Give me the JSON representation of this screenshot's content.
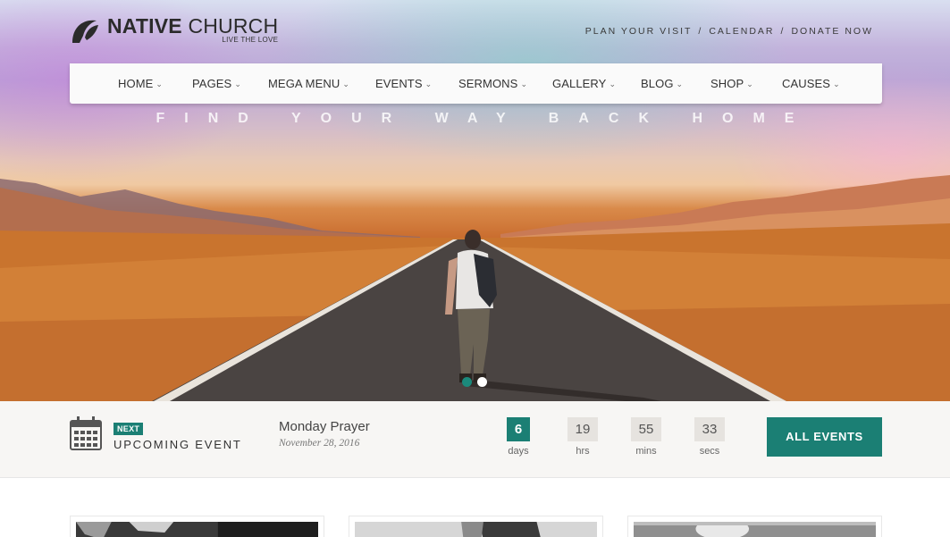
{
  "brand": {
    "name_bold": "NATIVE",
    "name_light": "CHURCH",
    "tagline": "LIVE THE LOVE",
    "logo_icon": "church-arc-logo-icon"
  },
  "top_links": [
    "PLAN YOUR VISIT",
    "CALENDAR",
    "DONATE NOW"
  ],
  "top_links_separator": "/",
  "nav": {
    "items": [
      "HOME",
      "PAGES",
      "MEGA MENU",
      "EVENTS",
      "SERMONS",
      "GALLERY",
      "BLOG",
      "SHOP",
      "CAUSES"
    ],
    "chevron": "⌄"
  },
  "hero": {
    "tagline": "FIND YOUR WAY BACK HOME",
    "slides_total": 2,
    "active_slide": 1
  },
  "event": {
    "badge": "NEXT",
    "section_label": "UPCOMING EVENT",
    "calendar_icon": "calendar-icon",
    "title": "Monday Prayer",
    "date": "November 28, 2016",
    "countdown": {
      "days": {
        "value": "6",
        "unit": "days"
      },
      "hours": {
        "value": "19",
        "unit": "hrs"
      },
      "mins": {
        "value": "55",
        "unit": "mins"
      },
      "secs": {
        "value": "33",
        "unit": "secs"
      }
    },
    "all_events_label": "ALL EVENTS"
  },
  "colors": {
    "accent": "#1b7f74",
    "slider_dot_active": "#1b8a7c"
  }
}
